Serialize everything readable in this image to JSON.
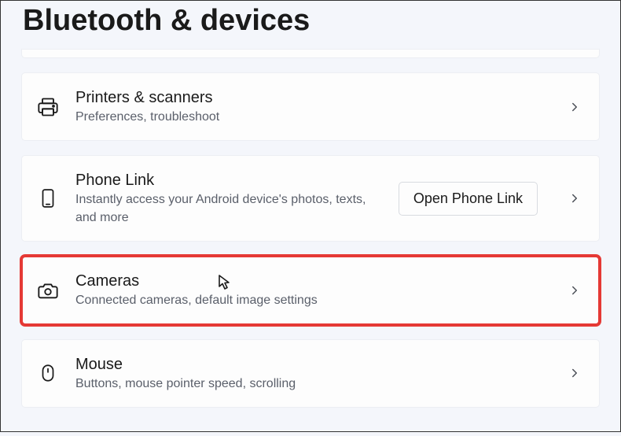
{
  "pageTitle": "Bluetooth & devices",
  "items": {
    "printers": {
      "title": "Printers & scanners",
      "subtitle": "Preferences, troubleshoot"
    },
    "phoneLink": {
      "title": "Phone Link",
      "subtitle": "Instantly access your Android device's photos, texts, and more",
      "buttonLabel": "Open Phone Link"
    },
    "cameras": {
      "title": "Cameras",
      "subtitle": "Connected cameras, default image settings"
    },
    "mouse": {
      "title": "Mouse",
      "subtitle": "Buttons, mouse pointer speed, scrolling"
    }
  }
}
